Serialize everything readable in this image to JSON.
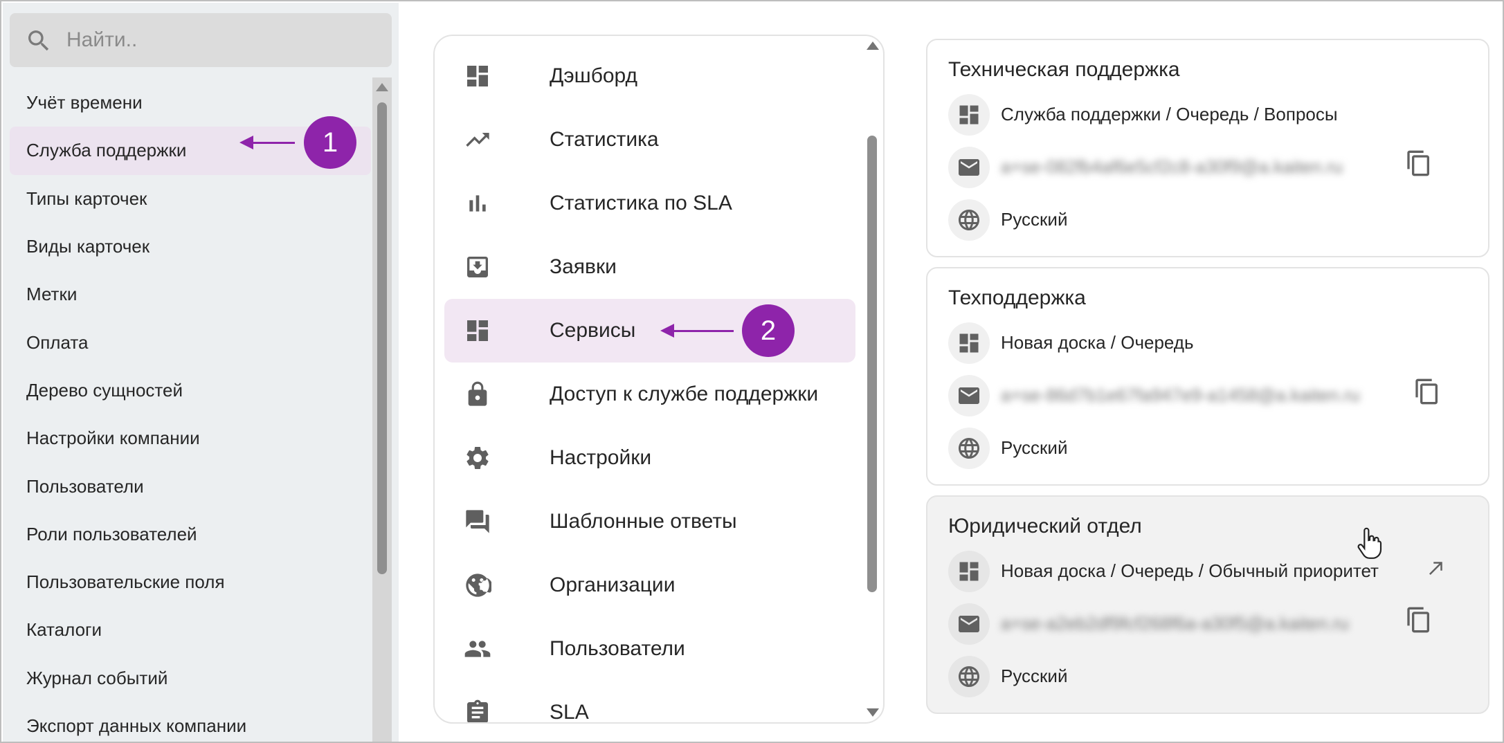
{
  "sidebar": {
    "search_placeholder": "Найти..",
    "items": [
      {
        "label": "Учёт времени"
      },
      {
        "label": "Служба поддержки"
      },
      {
        "label": "Типы карточек"
      },
      {
        "label": "Виды карточек"
      },
      {
        "label": "Метки"
      },
      {
        "label": "Оплата"
      },
      {
        "label": "Дерево сущностей"
      },
      {
        "label": "Настройки компании"
      },
      {
        "label": "Пользователи"
      },
      {
        "label": "Роли пользователей"
      },
      {
        "label": "Пользовательские поля"
      },
      {
        "label": "Каталоги"
      },
      {
        "label": "Журнал событий"
      },
      {
        "label": "Экспорт данных компании"
      }
    ],
    "active_index": 1
  },
  "menu": {
    "items": [
      {
        "label": "Дэшборд",
        "icon": "dashboard-icon"
      },
      {
        "label": "Статистика",
        "icon": "trending-up-icon"
      },
      {
        "label": "Статистика по SLA",
        "icon": "bar-chart-icon"
      },
      {
        "label": "Заявки",
        "icon": "inbox-icon"
      },
      {
        "label": "Сервисы",
        "icon": "dashboard-icon"
      },
      {
        "label": "Доступ к службе поддержки",
        "icon": "lock-icon"
      },
      {
        "label": "Настройки",
        "icon": "gear-icon"
      },
      {
        "label": "Шаблонные ответы",
        "icon": "forum-icon"
      },
      {
        "label": "Организации",
        "icon": "organization-icon"
      },
      {
        "label": "Пользователи",
        "icon": "people-icon"
      },
      {
        "label": "SLA",
        "icon": "clipboard-icon"
      }
    ],
    "active_index": 4
  },
  "callouts": {
    "first": "1",
    "second": "2"
  },
  "services": [
    {
      "title": "Техническая поддержка",
      "board": "Служба поддержки / Очередь / Вопросы",
      "email": "a+se-082fb4af6e5cf2c8-a30f9@a.kaiten.ru",
      "language": "Русский"
    },
    {
      "title": "Техподдержка",
      "board": "Новая доска / Очередь",
      "email": "a+se-86d7b1e67fa947e9-a1458@a.kaiten.ru",
      "language": "Русский"
    },
    {
      "title": "Юридический отдел",
      "board": "Новая доска / Очередь / Обычный приоритет",
      "email": "a+se-a2eb2df9fcf268f6a-a30f5@a.kaiten.ru",
      "language": "Русский"
    }
  ],
  "colors": {
    "accent": "#8e24aa",
    "active_bg": "#f2e7f3",
    "sidebar_bg": "#eceff1"
  }
}
